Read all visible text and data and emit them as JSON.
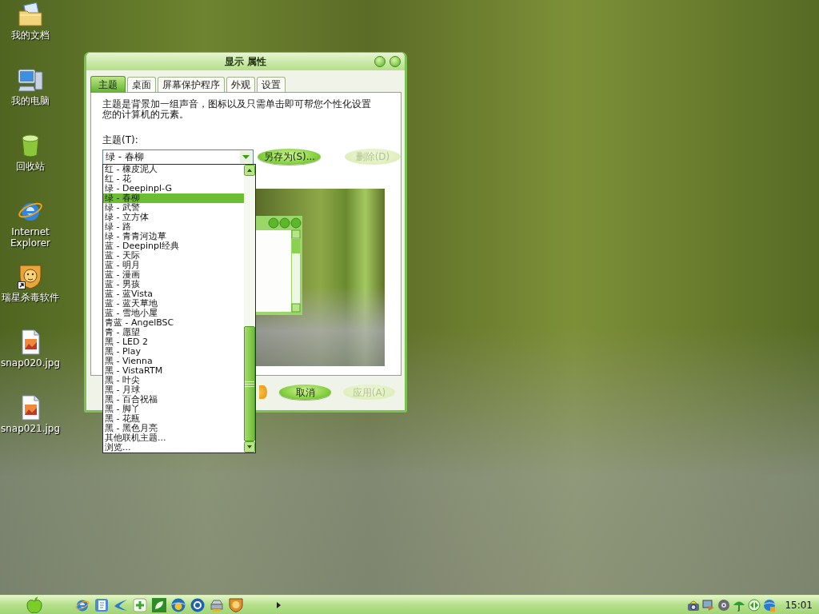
{
  "desktop_icons": [
    {
      "label": "我的文档",
      "kind": "documents",
      "shortcut": false
    },
    {
      "label": "我的电脑",
      "kind": "computer",
      "shortcut": false
    },
    {
      "label": "回收站",
      "kind": "bin",
      "shortcut": false
    },
    {
      "label": "Internet Explorer",
      "kind": "browser",
      "shortcut": false
    },
    {
      "label": "瑞星杀毒软件",
      "kind": "shield",
      "shortcut": true
    },
    {
      "label": "snap020.jpg",
      "kind": "image",
      "shortcut": false
    },
    {
      "label": "snap021.jpg",
      "kind": "image",
      "shortcut": false
    }
  ],
  "window": {
    "title": "显示 属性"
  },
  "tabs": [
    {
      "label": "主题",
      "selected": true
    },
    {
      "label": "桌面",
      "selected": false
    },
    {
      "label": "屏幕保护程序",
      "selected": false
    },
    {
      "label": "外观",
      "selected": false
    },
    {
      "label": "设置",
      "selected": false
    }
  ],
  "theme_page": {
    "description": "主题是背景加一组声音，图标以及只需单击即可帮您个性化设置您的计算机的元素。",
    "theme_label": "主题(T):",
    "theme_combo": {
      "value": "绿 - 春柳",
      "expanded": true,
      "items": [
        {
          "label": "红 - 橡皮泥人",
          "selected": false
        },
        {
          "label": "红 - 花",
          "selected": false
        },
        {
          "label": "绿 - Deepinpl-G",
          "selected": false
        },
        {
          "label": "绿 - 春柳",
          "selected": true
        },
        {
          "label": "绿 - 武警",
          "selected": false
        },
        {
          "label": "绿 - 立方体",
          "selected": false
        },
        {
          "label": "绿 - 路",
          "selected": false
        },
        {
          "label": "绿 - 青青河边草",
          "selected": false
        },
        {
          "label": "蓝 - Deepinpl经典",
          "selected": false
        },
        {
          "label": "蓝 - 天际",
          "selected": false
        },
        {
          "label": "蓝 - 明月",
          "selected": false
        },
        {
          "label": "蓝 - 漫画",
          "selected": false
        },
        {
          "label": "蓝 - 男孩",
          "selected": false
        },
        {
          "label": "蓝 - 蓝Vista",
          "selected": false
        },
        {
          "label": "蓝 - 蓝天草地",
          "selected": false
        },
        {
          "label": "蓝 - 雪地小屋",
          "selected": false
        },
        {
          "label": "青蓝 - AngelBSC",
          "selected": false
        },
        {
          "label": "青 - 愿望",
          "selected": false
        },
        {
          "label": "黑 - LED 2",
          "selected": false
        },
        {
          "label": "黑 - Play",
          "selected": false
        },
        {
          "label": "黑 - Vienna",
          "selected": false
        },
        {
          "label": "黑 - VistaRTM",
          "selected": false
        },
        {
          "label": "黑 - 叶尖",
          "selected": false
        },
        {
          "label": "黑 - 月球",
          "selected": false
        },
        {
          "label": "黑 - 百合祝福",
          "selected": false
        },
        {
          "label": "黑 - 脚丫",
          "selected": false
        },
        {
          "label": "黑 - 花瓶",
          "selected": false
        },
        {
          "label": "黑 - 黑色月亮",
          "selected": false
        },
        {
          "label": "其他联机主题...",
          "selected": false
        },
        {
          "label": "浏览...",
          "selected": false
        }
      ]
    },
    "buttons": [
      {
        "label": "另存为(S)...",
        "disabled": false
      },
      {
        "label": "删除(D)",
        "disabled": true
      }
    ]
  },
  "dialog_buttons": [
    {
      "label": "取消",
      "disabled": false
    },
    {
      "label": "应用(A)",
      "disabled": true
    }
  ],
  "taskbar": {
    "clock": "15:01"
  }
}
